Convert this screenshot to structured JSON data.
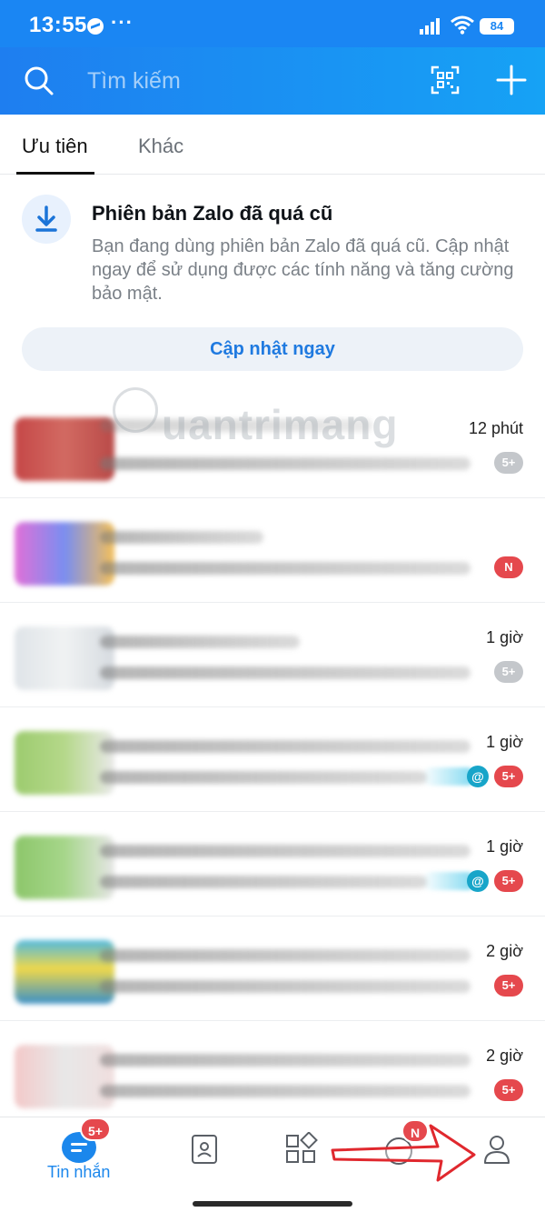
{
  "status_bar": {
    "time": "13:55",
    "dots": "···",
    "battery": "84"
  },
  "header": {
    "search_placeholder": "Tìm kiếm"
  },
  "tabs": [
    {
      "label": "Ưu tiên",
      "active": true
    },
    {
      "label": "Khác",
      "active": false
    }
  ],
  "update_card": {
    "title": "Phiên bản Zalo đã quá cũ",
    "description": "Bạn đang dùng phiên bản Zalo đã quá cũ. Cập nhật ngay để sử dụng được các tính năng và tăng cường bảo mật.",
    "button_label": "Cập nhật ngay"
  },
  "watermark": "uantrimang",
  "chats": [
    {
      "time": "12 phút",
      "badge": "5+",
      "badge_color": "gray",
      "mention": false
    },
    {
      "time": "",
      "badge": "N",
      "badge_color": "red",
      "mention": false
    },
    {
      "time": "1 giờ",
      "badge": "5+",
      "badge_color": "gray",
      "mention": false
    },
    {
      "time": "1 giờ",
      "badge": "5+",
      "badge_color": "red",
      "mention": true,
      "mention_symbol": "@"
    },
    {
      "time": "1 giờ",
      "badge": "5+",
      "badge_color": "red",
      "mention": true,
      "mention_symbol": "@"
    },
    {
      "time": "2 giờ",
      "badge": "5+",
      "badge_color": "red",
      "mention": false
    },
    {
      "time": "2 giờ",
      "badge": "5+",
      "badge_color": "red",
      "mention": false
    }
  ],
  "bottom_nav": {
    "messages_label": "Tin nhắn",
    "messages_badge": "5+",
    "timeline_badge": "N"
  },
  "colors": {
    "header": "#1e7ef0",
    "accent": "#1b87ec",
    "badge_red": "#e5484d",
    "badge_gray": "#c4c7cb",
    "arrow_red": "#e0282e"
  }
}
